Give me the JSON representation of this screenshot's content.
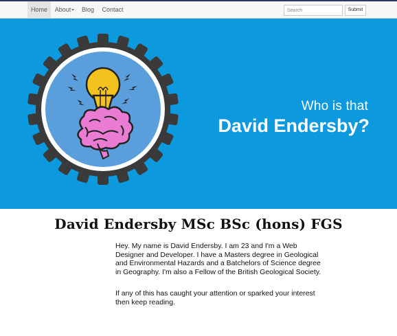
{
  "nav": {
    "items": [
      {
        "label": "Home",
        "active": true
      },
      {
        "label": "About",
        "dropdown": true
      },
      {
        "label": "Blog"
      },
      {
        "label": "Contact"
      }
    ],
    "search_placeholder": "Search",
    "submit_label": "Submit"
  },
  "hero": {
    "line1": "Who is that",
    "line2": "David Endersby?",
    "background_color": "#0c99de",
    "illustration": {
      "icon": "gear-brain-lightbulb-icon",
      "gear_color": "#3a3a3a",
      "disc_color": "#5a9fdc",
      "bulb_color": "#f3c21e",
      "brain_color": "#e97bd3"
    }
  },
  "main": {
    "title": "David Endersby MSc BSc (hons) FGS",
    "paragraph1": "Hey. My name is David Endersby. I am 23 and I'm a Web Designer and Developer. I have a Masters degree in Geological and Environmental Hazards and a Batchelors of Science degree in Geography. I'm also a Fellow of the British Geological Society.",
    "paragraph2": "If any of this has caught your attention or sparked your interest then keep reading."
  }
}
